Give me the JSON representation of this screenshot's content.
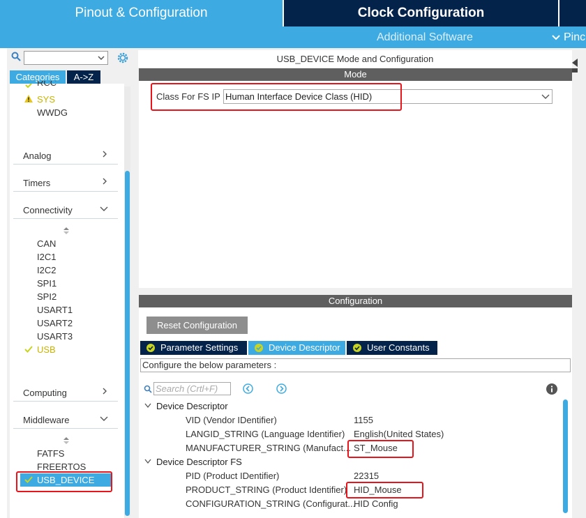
{
  "header": {
    "tab_pinout": "Pinout & Configuration",
    "tab_clock": "Clock Configuration",
    "sub_additional": "Additional Software",
    "sub_pinout": "Pinc"
  },
  "left": {
    "search_value": "",
    "tab_categories": "Categories",
    "tab_az": "A->Z",
    "system_items": [
      {
        "label": "RCC",
        "status": "check"
      },
      {
        "label": "SYS",
        "status": "warning"
      },
      {
        "label": "WWDG",
        "status": "none"
      }
    ],
    "categories": {
      "analog": "Analog",
      "timers": "Timers",
      "connectivity": "Connectivity",
      "computing": "Computing",
      "middleware": "Middleware"
    },
    "connectivity_items": [
      "CAN",
      "I2C1",
      "I2C2",
      "SPI1",
      "SPI2",
      "USART1",
      "USART2",
      "USART3",
      "USB"
    ],
    "middleware_items": [
      "FATFS",
      "FREERTOS",
      "USB_DEVICE"
    ]
  },
  "main": {
    "panel_title": "USB_DEVICE Mode and Configuration",
    "mode_title": "Mode",
    "class_label": "Class For FS IP",
    "class_value": "Human Interface Device Class (HID)",
    "config_title": "Configuration",
    "reset_button": "Reset Configuration",
    "tabs": [
      "Parameter Settings",
      "Device Descriptor",
      "User Constants"
    ],
    "configure_text": "Configure the below parameters :",
    "search_placeholder": "Search (Crtl+F)",
    "tree": {
      "group1": "Device Descriptor",
      "group2": "Device Descriptor FS",
      "rows": [
        {
          "name": "VID (Vendor IDentifier)",
          "value": "1155"
        },
        {
          "name": "LANGID_STRING (Language Identifier)",
          "value": "English(United States)"
        },
        {
          "name": "MANUFACTURER_STRING (Manufact...",
          "value": "ST_Mouse"
        },
        {
          "name": "PID (Product IDentifier)",
          "value": "22315"
        },
        {
          "name": "PRODUCT_STRING (Product Identifier)",
          "value": "HID_Mouse"
        },
        {
          "name": "CONFIGURATION_STRING (Configurat...",
          "value": "HID Config"
        }
      ]
    }
  },
  "colors": {
    "accent": "#3dabe1",
    "dark": "#03234b",
    "highlight": "#e8141c",
    "check": "#c8d41e"
  }
}
